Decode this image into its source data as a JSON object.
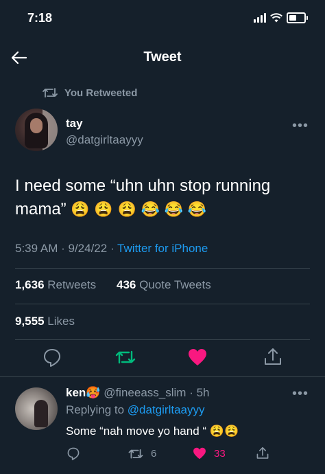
{
  "status": {
    "time": "7:18"
  },
  "header": {
    "title": "Tweet"
  },
  "retweet_note": "You Retweeted",
  "tweet": {
    "name": "tay",
    "handle": "@datgirltaayyy",
    "text_line1": "I need some “uhn uhn stop running",
    "text_line2": "mama”",
    "emojis": [
      "😩",
      "😩",
      "😩",
      "😂",
      "😂",
      "😂"
    ],
    "time": "5:39 AM",
    "date": "9/24/22",
    "source": "Twitter for iPhone",
    "retweets_count": "1,636",
    "retweets_label": "Retweets",
    "quotes_count": "436",
    "quotes_label": "Quote Tweets",
    "likes_count": "9,555",
    "likes_label": "Likes"
  },
  "reply": {
    "name": "ken",
    "name_emoji": "🥵",
    "handle": "@fineeass_slim",
    "age": "5h",
    "replying_prefix": "Replying to",
    "replying_to": "@datgirltaayyy",
    "text": "Some “nah move yo hand “",
    "text_emojis": [
      "😩",
      "😩"
    ],
    "retweet_count": "6",
    "like_count": "33"
  },
  "colors": {
    "background": "#15202b",
    "accent": "#1d9bf0",
    "like": "#f91880",
    "retweet_green": "#00ba7c",
    "muted": "#8b98a5"
  },
  "icons": [
    "back-arrow-icon",
    "retweet-icon",
    "more-icon",
    "reply-icon",
    "heart-icon",
    "share-icon",
    "signal-icon",
    "wifi-icon",
    "battery-icon"
  ]
}
